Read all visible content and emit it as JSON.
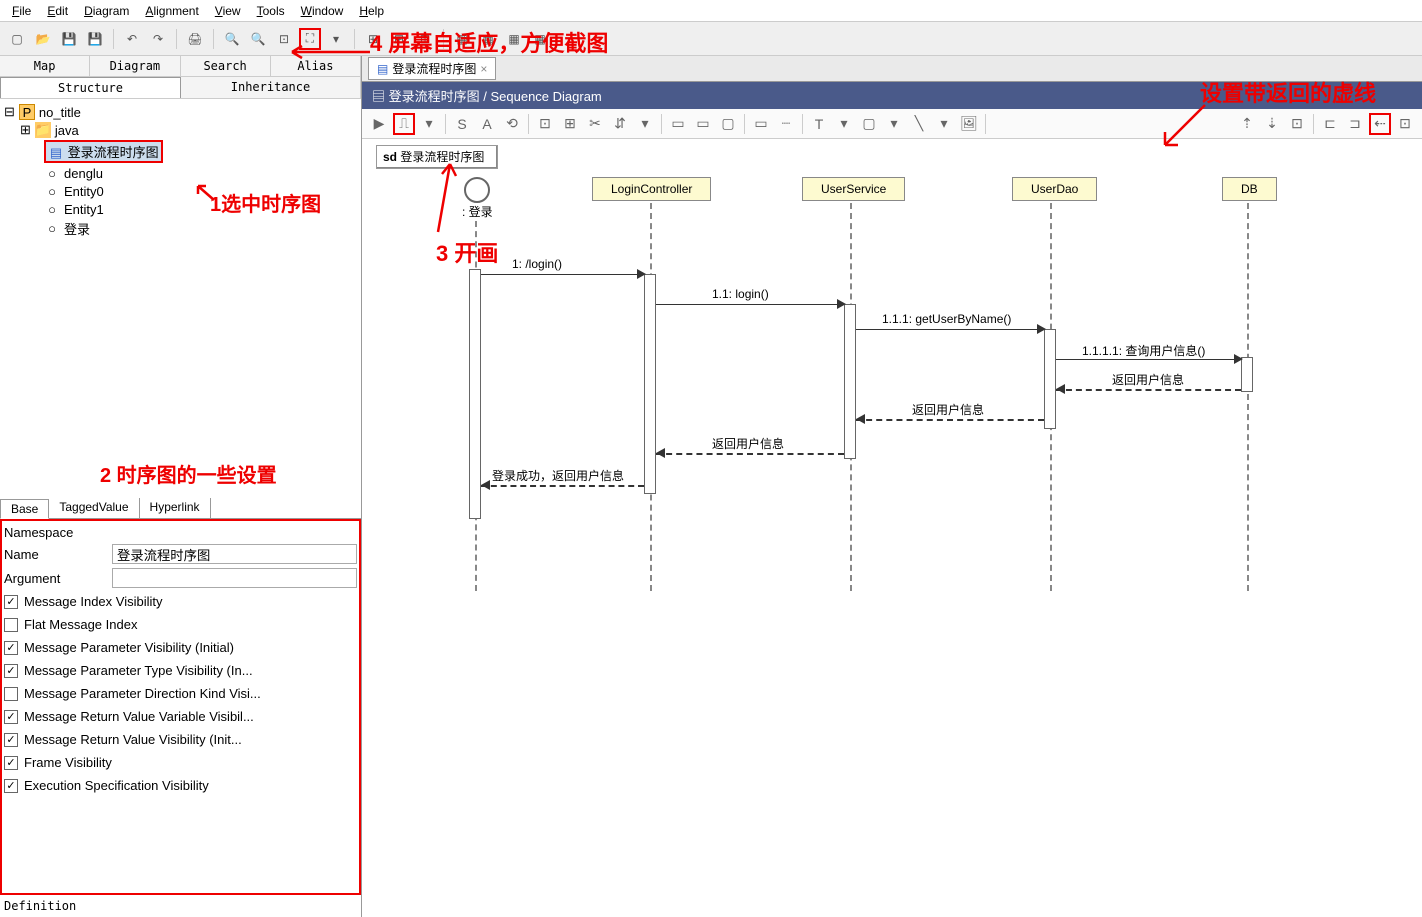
{
  "menu": {
    "file": "File",
    "edit": "Edit",
    "diagram": "Diagram",
    "alignment": "Alignment",
    "view": "View",
    "tools": "Tools",
    "window": "Window",
    "help": "Help"
  },
  "leftTabs": {
    "map": "Map",
    "diagram": "Diagram",
    "search": "Search",
    "alias": "Alias",
    "structure": "Structure",
    "inheritance": "Inheritance"
  },
  "tree": {
    "root": "no_title",
    "java": "java",
    "seq": "登录流程时序图",
    "denglu": "denglu",
    "entity0": "Entity0",
    "entity1": "Entity1",
    "login": "登录"
  },
  "propTabs": {
    "base": "Base",
    "tagged": "TaggedValue",
    "hyperlink": "Hyperlink"
  },
  "props": {
    "namespace_label": "Namespace",
    "name_label": "Name",
    "name_value": "登录流程时序图",
    "argument_label": "Argument",
    "c1": "Message Index Visibility",
    "c2": "Flat Message Index",
    "c3": "Message Parameter Visibility (Initial)",
    "c4": "Message Parameter Type Visibility (In...",
    "c5": "Message Parameter Direction Kind Visi...",
    "c6": "Message Return Value Variable Visibil...",
    "c7": "Message Return Value Visibility (Init...",
    "c8": "Frame Visibility",
    "c9": "Execution Specification Visibility"
  },
  "definition": "Definition",
  "editor": {
    "tab": "登录流程时序图",
    "title": "登录流程时序图 / Sequence Diagram",
    "frame_prefix": "sd",
    "frame_name": "登录流程时序图"
  },
  "diagram": {
    "actor": " : 登录",
    "l1": "LoginController",
    "l2": "UserService",
    "l3": "UserDao",
    "l4": "DB",
    "m1": "1: /login()",
    "m2": "1.1: login()",
    "m3": "1.1.1: getUserByName()",
    "m4": "1.1.1.1: 查询用户信息()",
    "r1": "返回用户信息",
    "r2": "返回用户信息",
    "r3": "返回用户信息",
    "r4": "登录成功，返回用户信息"
  },
  "annot": {
    "a1": "1选中时序图",
    "a2": "2 时序图的一些设置",
    "a3": "3 开画",
    "a4": "4 屏幕自适应，方便截图",
    "a5": "设置带返回的虚线"
  }
}
